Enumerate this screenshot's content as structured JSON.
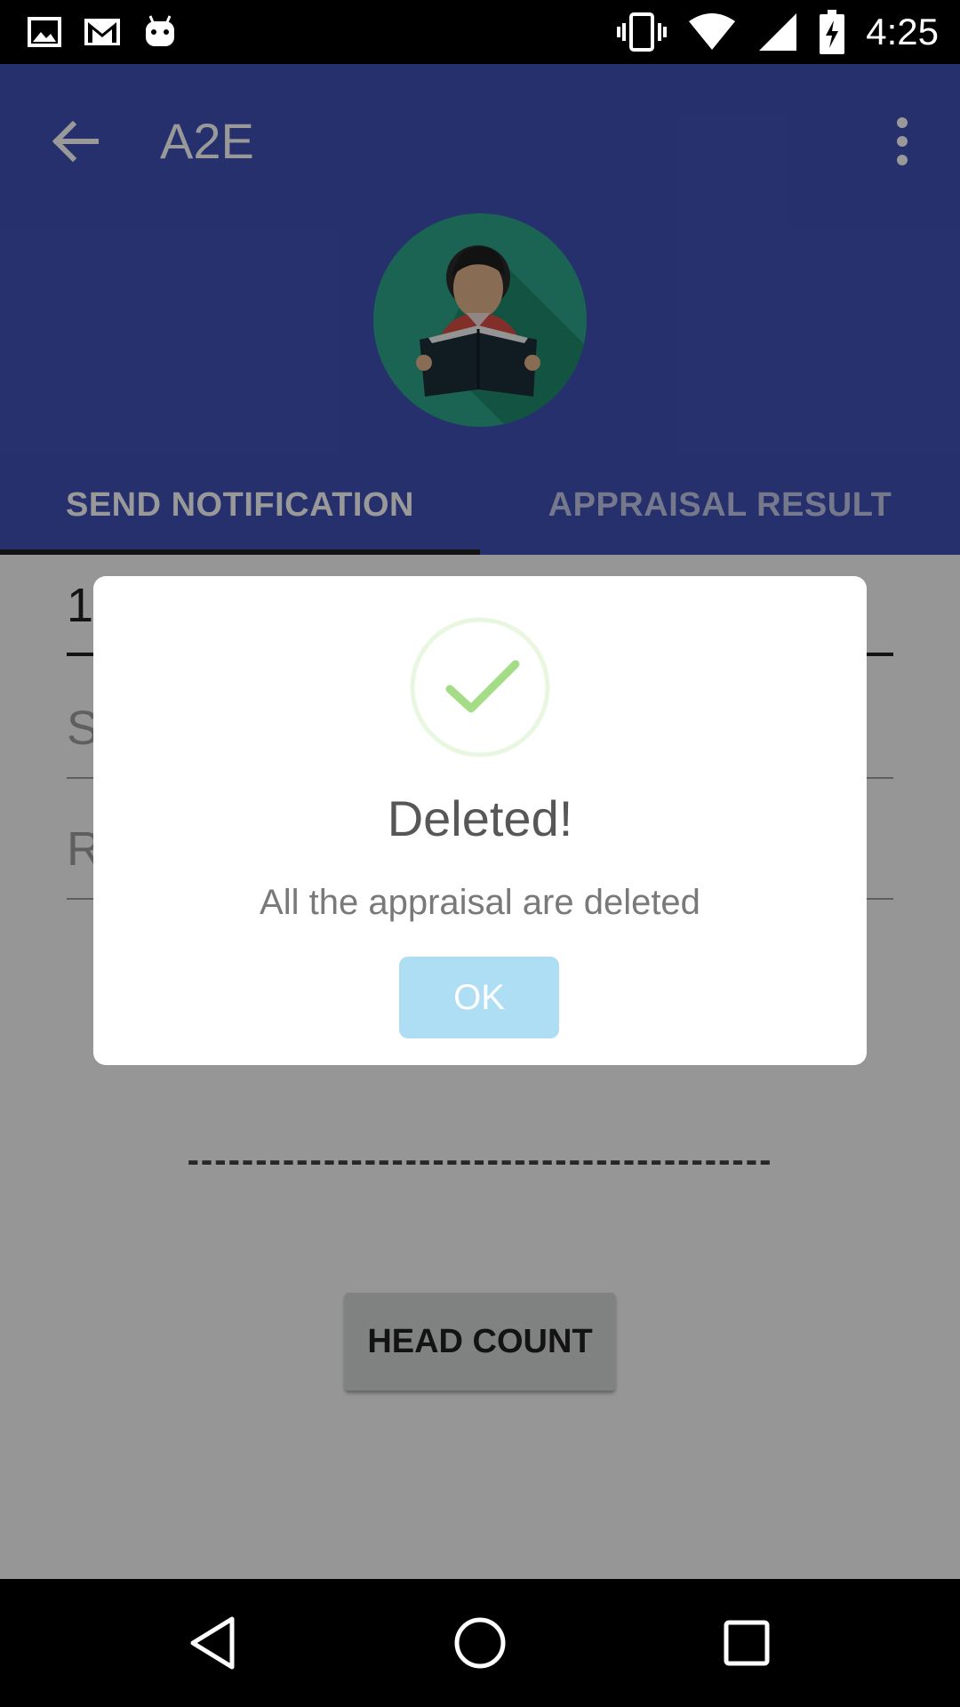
{
  "status_bar": {
    "time": "4:25",
    "left_icons": [
      "image-icon",
      "gmail-icon",
      "android-icon"
    ],
    "right_icons": [
      "vibrate-icon",
      "wifi-icon",
      "signal-icon",
      "battery-charging-icon"
    ]
  },
  "app_bar": {
    "title": "A2E",
    "back_icon": "arrow-back-icon",
    "menu_icon": "more-vert-icon"
  },
  "tabs": [
    {
      "label": "SEND NOTIFICATION",
      "selected": true
    },
    {
      "label": "APPRAISAL RESULT",
      "selected": false
    }
  ],
  "form": {
    "fields": [
      {
        "value": "1"
      },
      {
        "placeholder": "S"
      },
      {
        "placeholder": "R"
      }
    ],
    "divider_text": "-------------------------------------------",
    "head_count_button": "HEAD COUNT"
  },
  "dialog": {
    "title": "Deleted!",
    "message": "All the appraisal are deleted",
    "ok_button": "OK",
    "icon": "success-check-icon"
  },
  "nav_bar": {
    "icons": [
      "back-triangle-icon",
      "home-circle-icon",
      "recents-square-icon"
    ]
  },
  "colors": {
    "primary": "#3f51b5",
    "overlay": "rgba(0,0,0,0.4)",
    "success_green": "#a5dc86",
    "ok_button": "#aedef4"
  }
}
